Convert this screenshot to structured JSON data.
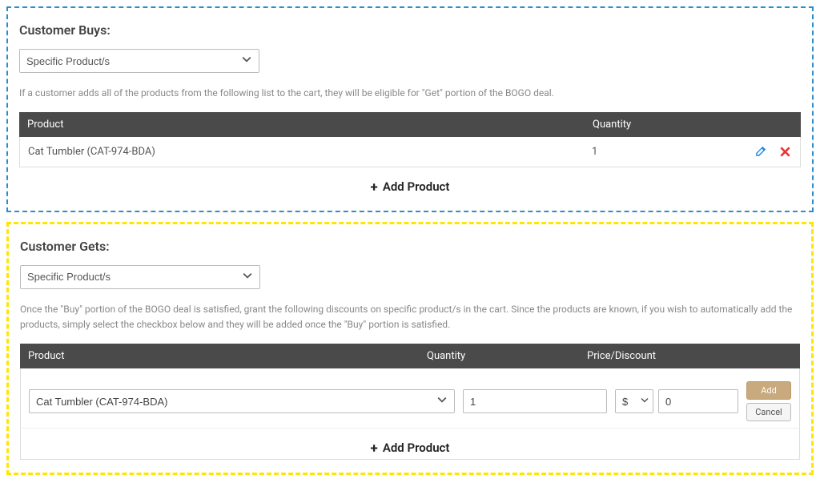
{
  "buys": {
    "title": "Customer Buys:",
    "select_value": "Specific Product/s",
    "help": "If a customer adds all of the products from the following list to the cart, they will be eligible for \"Get\" portion of the BOGO deal.",
    "headers": {
      "product": "Product",
      "quantity": "Quantity"
    },
    "row": {
      "product": "Cat Tumbler (CAT-974-BDA)",
      "quantity": "1"
    },
    "add_label": "Add Product"
  },
  "gets": {
    "title": "Customer Gets:",
    "select_value": "Specific Product/s",
    "help": "Once the \"Buy\" portion of the BOGO deal is satisfied, grant the following discounts on specific product/s in the cart. Since the products are known, if you wish to automatically add the products, simply select the checkbox below and they will be added once the \"Buy\" portion is satisfied.",
    "headers": {
      "product": "Product",
      "quantity": "Quantity",
      "price": "Price/Discount"
    },
    "edit": {
      "product": "Cat Tumbler (CAT-974-BDA)",
      "quantity": "1",
      "unit": "$",
      "price": "0",
      "add_btn": "Add",
      "cancel_btn": "Cancel"
    },
    "add_label": "Add Product"
  }
}
